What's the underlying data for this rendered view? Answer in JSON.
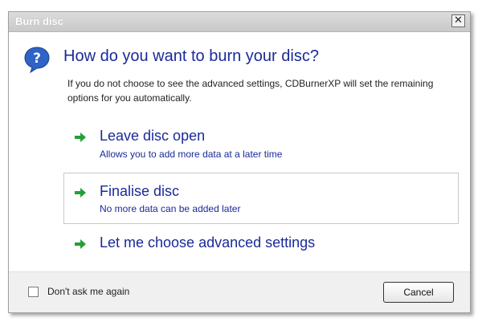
{
  "window": {
    "title": "Burn disc",
    "close_glyph": "✕"
  },
  "dialog": {
    "icon": "question-icon",
    "heading": "How do you want to burn your disc?",
    "description": "If you do not choose to see the advanced settings, CDBurnerXP will set the remaining options for you automatically."
  },
  "options": [
    {
      "title": "Leave disc open",
      "subtitle": "Allows you to add more data at a later time",
      "selected": false
    },
    {
      "title": "Finalise disc",
      "subtitle": "No more data can be added later",
      "selected": true
    },
    {
      "title": "Let me choose advanced settings",
      "subtitle": "",
      "selected": false
    }
  ],
  "footer": {
    "checkbox_label": "Don't ask me again",
    "checkbox_checked": false,
    "cancel_label": "Cancel"
  },
  "colors": {
    "link_blue": "#1a2a99",
    "arrow_green": "#22a03a",
    "icon_blue": "#2f63c6"
  }
}
